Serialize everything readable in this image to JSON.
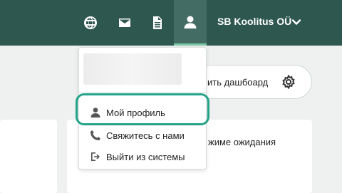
{
  "header": {
    "company_name": "SB Koolitus OÜ",
    "icons": [
      "globe-icon",
      "mail-icon",
      "document-icon",
      "user-icon",
      "chevron-down-icon"
    ]
  },
  "toolbar": {
    "dashboard_button_label": "ить дашбоард"
  },
  "cards": {
    "standby_text": "жиме ожидания"
  },
  "user_menu": {
    "items": [
      {
        "label": "Мой профиль",
        "icon": "user-icon"
      },
      {
        "label": "Свяжитесь с нами",
        "icon": "phone-icon"
      },
      {
        "label": "Выйти из системы",
        "icon": "logout-icon"
      }
    ]
  },
  "colors": {
    "header_bg": "#2e5750",
    "active_icon_bg": "#436c65",
    "highlight": "#22a38a"
  }
}
